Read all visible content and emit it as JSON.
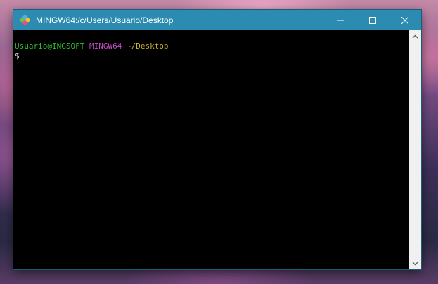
{
  "window": {
    "title": "MINGW64:/c/Users/Usuario/Desktop",
    "icon": "git-bash-icon",
    "controls": [
      "minimize-icon",
      "maximize-icon",
      "close-icon"
    ]
  },
  "terminal": {
    "prompt_user": "Usuario@INGSOFT",
    "prompt_env": "MINGW64",
    "prompt_path": "~/Desktop",
    "prompt_symbol": "$"
  },
  "colors": {
    "titlebar": "#2b8bb0",
    "user": "#2cbf2c",
    "env": "#c04dc0",
    "path": "#c9b42a",
    "terminal_bg": "#000000"
  }
}
